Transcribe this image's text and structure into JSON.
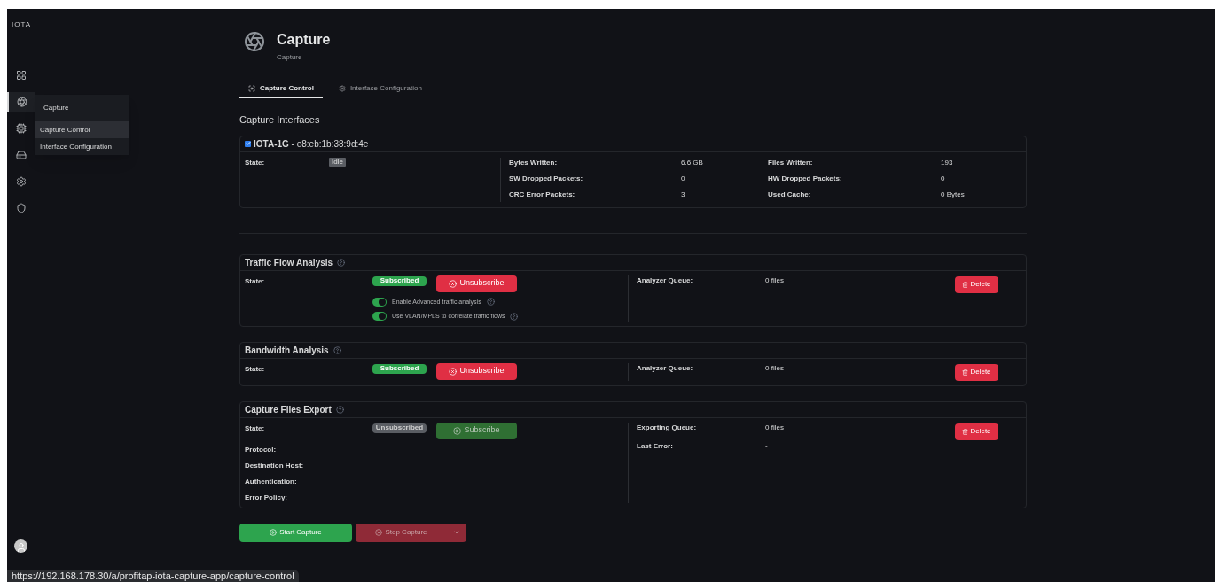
{
  "logo": "IOTA",
  "sidebar": {
    "items": [
      {
        "kind": "grid",
        "selected": false
      },
      {
        "kind": "aperture",
        "selected": true
      },
      {
        "kind": "chip",
        "selected": false
      },
      {
        "kind": "drive",
        "selected": false
      },
      {
        "kind": "gear",
        "selected": false
      },
      {
        "kind": "shield",
        "selected": false
      }
    ]
  },
  "flyout": {
    "title": "Capture",
    "items": [
      {
        "label": "Capture Control",
        "selected": true
      },
      {
        "label": "Interface Configuration",
        "selected": false
      }
    ]
  },
  "header": {
    "title": "Capture",
    "subtitle": "Capture"
  },
  "tabs": [
    {
      "label": "Capture Control",
      "selected": true
    },
    {
      "label": "Interface Configuration",
      "selected": false
    }
  ],
  "section_title": "Capture Interfaces",
  "interface": {
    "checked": true,
    "name": "IOTA-1G",
    "mac": " - e8:eb:1b:38:9d:4e",
    "state_label": "State:",
    "state": "Idle",
    "stats": [
      {
        "label": "Bytes Written:",
        "value": "6.6 GB"
      },
      {
        "label": "Files Written:",
        "value": "193"
      },
      {
        "label": "SW Dropped Packets:",
        "value": "0"
      },
      {
        "label": "HW Dropped Packets:",
        "value": "0"
      },
      {
        "label": "CRC Error Packets:",
        "value": "3"
      },
      {
        "label": "Used Cache:",
        "value": "0 Bytes"
      }
    ]
  },
  "panels": [
    {
      "title": "Traffic Flow Analysis",
      "state_label": "State:",
      "status": {
        "label": "Subscribed",
        "subscribed": true
      },
      "action": {
        "label": "Unsubscribe",
        "kind": "unsubscribe"
      },
      "toggles": [
        {
          "label": "Enable Advanced traffic analysis",
          "on": true
        },
        {
          "label": "Use VLAN/MPLS to correlate traffic flows",
          "on": true
        }
      ],
      "right": [
        {
          "label": "Analyzer Queue:",
          "value": "0 files"
        }
      ],
      "delete": "Delete"
    },
    {
      "title": "Bandwidth Analysis",
      "state_label": "State:",
      "status": {
        "label": "Subscribed",
        "subscribed": true
      },
      "action": {
        "label": "Unsubscribe",
        "kind": "unsubscribe"
      },
      "right": [
        {
          "label": "Analyzer Queue:",
          "value": "0 files"
        }
      ],
      "delete": "Delete"
    },
    {
      "title": "Capture Files Export",
      "state_label": "State:",
      "status": {
        "label": "Unsubscribed",
        "subscribed": false
      },
      "action": {
        "label": "Subscribe",
        "kind": "subscribe"
      },
      "fields": [
        "Protocol:",
        "Destination Host:",
        "Authentication:",
        "Error Policy:"
      ],
      "right": [
        {
          "label": "Exporting Queue:",
          "value": "0 files"
        },
        {
          "label": "Last Error:",
          "value": "-"
        }
      ],
      "delete": "Delete"
    }
  ],
  "footer": {
    "start": "Start Capture",
    "stop": {
      "label": "Stop Capture",
      "disabled": true
    }
  },
  "status_url": "https://192.168.178.30/a/profitap-iota-capture-app/capture-control"
}
